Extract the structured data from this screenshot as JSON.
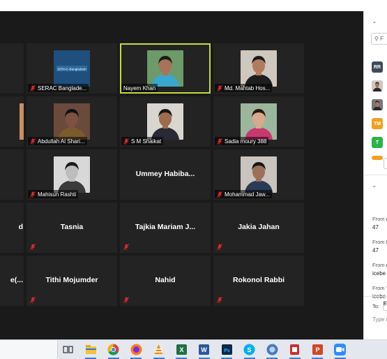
{
  "participants": [
    {
      "id": "r0c0",
      "name": "",
      "type": "blank",
      "muted": false,
      "active": false
    },
    {
      "id": "serac",
      "name": "SERAC Banglade...",
      "type": "logo",
      "logo_text": "SERAC-Bangladesh",
      "muted": true,
      "active": false
    },
    {
      "id": "nayem",
      "name": "Nayem Khan",
      "type": "photo",
      "muted": false,
      "active": true,
      "bg": "#6c9a68",
      "skin": "#a8735a",
      "shirt": "#3aa7cf",
      "hair": "#1a1a1a"
    },
    {
      "id": "mahtab",
      "name": "Md. Mahtab Hos...",
      "type": "photo",
      "muted": true,
      "active": false,
      "bg": "#cfc8bf",
      "skin": "#b17c5e",
      "shirt": "#1e1e1e",
      "hair": "#1a1a1a"
    },
    {
      "id": "r1c0",
      "name": "",
      "type": "edge-photo",
      "muted": false,
      "active": false
    },
    {
      "id": "abdullah",
      "name": "Abdullah Al Shari...",
      "type": "photo",
      "muted": true,
      "active": false,
      "bg": "#6a4a3c",
      "skin": "#7c5341",
      "shirt": "#7b5a2c",
      "hair": "#111111"
    },
    {
      "id": "shaikat",
      "name": "S M Shaikat",
      "type": "photo",
      "muted": true,
      "active": false,
      "bg": "#d9d6d2",
      "skin": "#9c6c50",
      "shirt": "#2a2a36",
      "hair": "#161616"
    },
    {
      "id": "sadia",
      "name": "Sadia moury 388",
      "type": "photo",
      "muted": true,
      "active": false,
      "bg": "#9bb69c",
      "skin": "#d7a98f",
      "shirt": "#c8386e",
      "hair": "#2a1812"
    },
    {
      "id": "r2c0",
      "name": "",
      "type": "blank",
      "muted": false,
      "active": false
    },
    {
      "id": "mahisun",
      "name": "Mahisun Rashti",
      "type": "photo",
      "muted": true,
      "active": false,
      "bg": "#d8d8d8",
      "skin": "#bdbdbd",
      "shirt": "#3a3a3a",
      "hair": "#1c1c1c"
    },
    {
      "id": "ummey",
      "name": "Ummey  Habiba...",
      "type": "text",
      "muted": false,
      "active": false
    },
    {
      "id": "mohammad",
      "name": "Mohammad Jaw...",
      "type": "photo",
      "muted": true,
      "active": false,
      "bg": "#c9c4bd",
      "skin": "#9c7059",
      "shirt": "#2b3b56",
      "hair": "#161616"
    },
    {
      "id": "r3c0",
      "name": "d",
      "type": "edge-text",
      "muted": true,
      "active": false
    },
    {
      "id": "tasnia",
      "name": "Tasnia",
      "type": "text",
      "muted": true,
      "active": false
    },
    {
      "id": "tajkia",
      "name": "Tajkia  Mariam  J...",
      "type": "text",
      "muted": true,
      "active": false
    },
    {
      "id": "jakia",
      "name": "Jakia Jahan",
      "type": "text",
      "muted": true,
      "active": false
    },
    {
      "id": "r4c0",
      "name": "e(...",
      "type": "edge-text",
      "muted": true,
      "active": false
    },
    {
      "id": "tithi",
      "name": "Tithi Mojumder",
      "type": "text",
      "muted": true,
      "active": false
    },
    {
      "id": "nahid",
      "name": "Nahid",
      "type": "text",
      "muted": true,
      "active": false
    },
    {
      "id": "rokonol",
      "name": "Rokonol Rabbi",
      "type": "text",
      "muted": true,
      "active": false
    }
  ],
  "panel": {
    "search_placeholder": "F",
    "avatars": [
      {
        "label": "RR",
        "color": "#3c4a5c",
        "type": "initials"
      },
      {
        "label": "",
        "color": "#cfc8bf",
        "type": "photo"
      },
      {
        "label": "",
        "color": "#777777",
        "type": "photo"
      },
      {
        "label": "TM",
        "color": "#f0a020",
        "type": "initials"
      },
      {
        "label": "T",
        "color": "#2db24a",
        "type": "initials"
      }
    ],
    "chat": [
      {
        "from": "From A",
        "text": "47"
      },
      {
        "from": "From I",
        "text": "47"
      },
      {
        "from": "From A",
        "text": "icebe"
      },
      {
        "from": "From T",
        "text": "icebe"
      }
    ],
    "to_label": "To:",
    "to_value": "E",
    "type_placeholder": "Type m"
  },
  "taskbar": {
    "apps": [
      "task-view",
      "file-explorer",
      "chrome",
      "firefox",
      "vlc",
      "excel",
      "word",
      "photoshop",
      "skype",
      "network",
      "app-red",
      "powerpoint",
      "zoom"
    ],
    "labels": {
      "excel": "X",
      "word": "W",
      "photoshop": "Ps",
      "skype": "S",
      "powerpoint": "P"
    }
  },
  "colors": {
    "gallery_bg": "#1a1a1a",
    "tile_bg": "#232323",
    "active_border": "#c3dc3a",
    "mute_red": "#e0282a",
    "zoom_blue": "#2d8cff"
  }
}
